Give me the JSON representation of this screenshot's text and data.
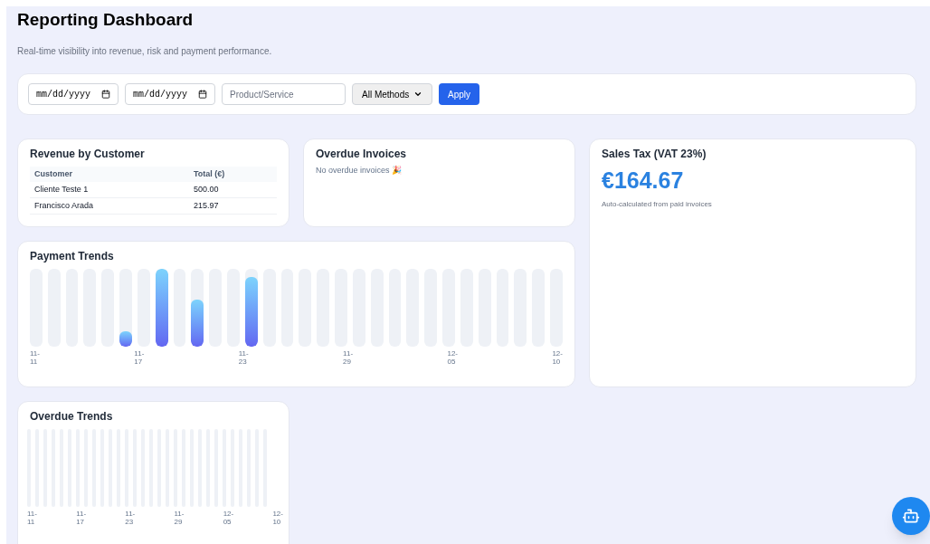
{
  "header": {
    "title": "Reporting Dashboard",
    "subtitle": "Real-time visibility into revenue, risk and payment performance."
  },
  "filters": {
    "date_from": {
      "placeholder": "mm/dd/yyyy"
    },
    "date_to": {
      "placeholder": "mm/dd/yyyy"
    },
    "product": {
      "placeholder": "Product/Service"
    },
    "method": {
      "value": "All Methods"
    },
    "apply": "Apply"
  },
  "revenue": {
    "title": "Revenue by Customer",
    "columns": [
      "Customer",
      "Total (€)"
    ],
    "rows": [
      [
        "Cliente Teste 1",
        "500.00"
      ],
      [
        "Francisco Arada",
        "215.97"
      ]
    ]
  },
  "overdue": {
    "title": "Overdue Invoices",
    "message": "No overdue invoices 🎉"
  },
  "sales_tax": {
    "title": "Sales Tax (VAT 23%)",
    "amount": "€164.67",
    "note": "Auto-calculated from paid invoices"
  },
  "payment_trends": {
    "title": "Payment Trends",
    "labels": [
      "11-11",
      "11-17",
      "11-23",
      "11-29",
      "12-05",
      "12-10"
    ]
  },
  "overdue_trends": {
    "title": "Overdue Trends",
    "labels": [
      "11-11",
      "11-17",
      "11-23",
      "11-29",
      "12-05",
      "12-10"
    ]
  }
}
